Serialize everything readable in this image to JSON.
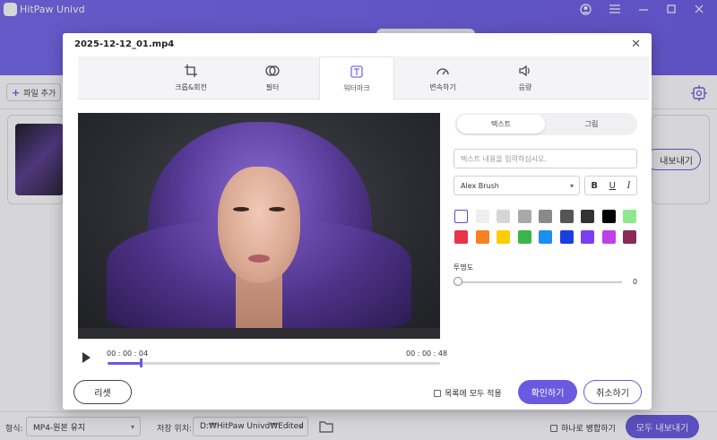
{
  "app": {
    "title": "HitPaw Univd"
  },
  "toolbar": {
    "add_file_label": "파일 추가"
  },
  "background": {
    "export_label": "내보내기"
  },
  "bottom": {
    "format_label": "형식:",
    "format_value": "MP4-원본 유지",
    "save_label": "저장 위치:",
    "save_value": "D:₩HitPaw Univd₩Edited",
    "merge_label": "하나로 병합하기",
    "export_all_label": "모두 내보내기"
  },
  "modal": {
    "title": "2025-12-12_01.mp4",
    "tabs": [
      {
        "label": "크롭&회전",
        "icon": "crop-icon"
      },
      {
        "label": "필터",
        "icon": "filter-icon"
      },
      {
        "label": "워터마크",
        "icon": "watermark-icon",
        "active": true
      },
      {
        "label": "변속하기",
        "icon": "speed-icon"
      },
      {
        "label": "음량",
        "icon": "volume-icon"
      }
    ],
    "player": {
      "current_time": "00 : 00 : 04",
      "total_time": "00 : 00 : 48",
      "progress": 0.1
    },
    "watermark": {
      "mode_tabs": [
        "텍스트",
        "그림"
      ],
      "active_mode": "텍스트",
      "text_placeholder": "텍스트 내용을 입력하십시오.",
      "font": "Alex Brush",
      "bold": "B",
      "underline": "U",
      "italic": "I",
      "colors": [
        "#ffffff",
        "#eeeeee",
        "#d6d6d6",
        "#a9a9a9",
        "#8a8a8a",
        "#555555",
        "#333333",
        "#000000",
        "#8ee88e",
        "#e8334a",
        "#f58220",
        "#ffcc00",
        "#3bb54a",
        "#1b8ef0",
        "#1a3fe0",
        "#7b3ff0",
        "#c040e8",
        "#8a2a55"
      ],
      "opacity_label": "투명도",
      "opacity_value": "0"
    },
    "buttons": {
      "reset": "리셋",
      "apply_all": "목록에 모두 적용",
      "confirm": "확인하기",
      "cancel": "취소하기"
    }
  }
}
